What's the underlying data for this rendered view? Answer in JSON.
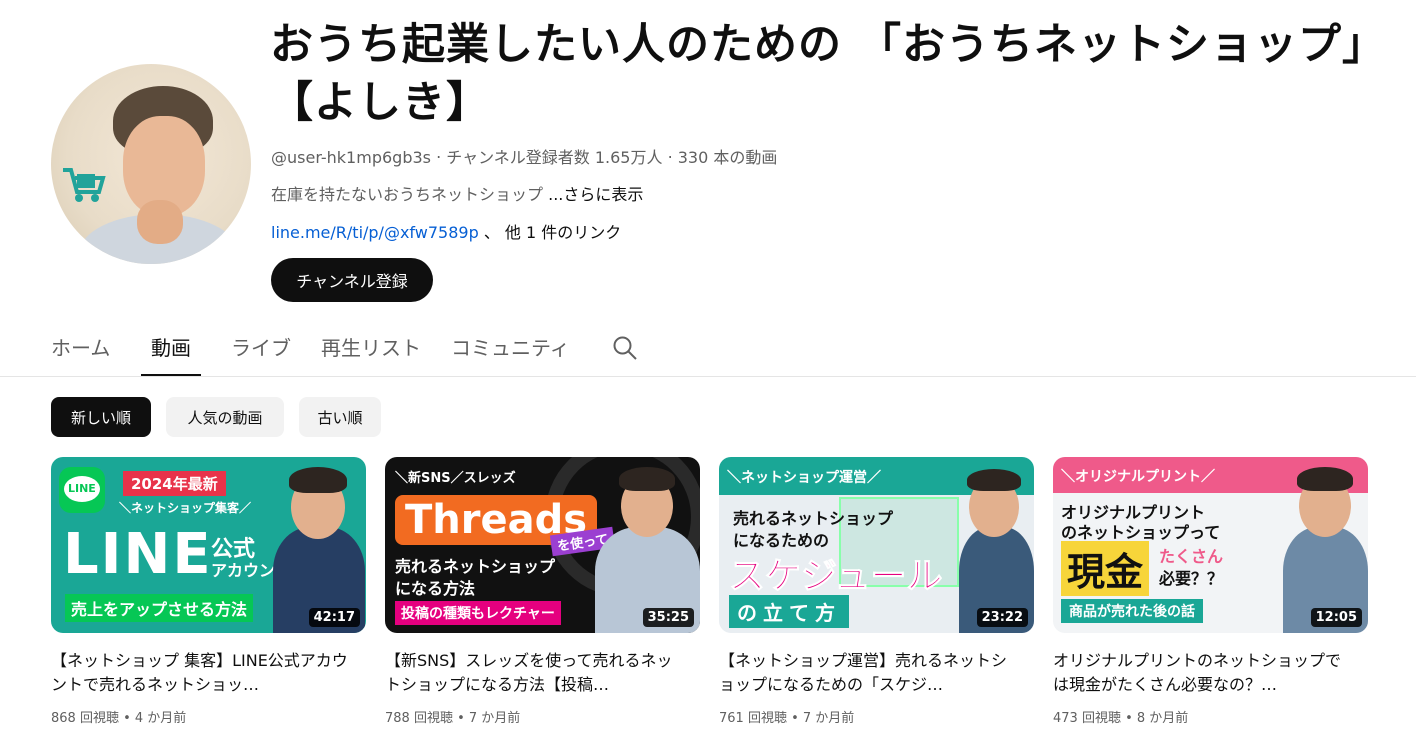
{
  "channel": {
    "title": "おうち起業したい人のための 「おうちネットショップ」【よしき】",
    "handle": "@user-hk1mp6gb3s",
    "subscribers": "チャンネル登録者数 1.65万人",
    "video_count": "330 本の動画",
    "description": "在庫を持たないおうちネットショップ",
    "more_label": "...さらに表示",
    "link": "line.me/R/ti/p/@xfw7589p",
    "other_links": "、 他 1 件のリンク",
    "subscribe_label": "チャンネル登録"
  },
  "tabs": [
    {
      "label": "ホーム"
    },
    {
      "label": "動画"
    },
    {
      "label": "ライブ"
    },
    {
      "label": "再生リスト"
    },
    {
      "label": "コミュニティ"
    }
  ],
  "chips": [
    {
      "label": "新しい順"
    },
    {
      "label": "人気の動画"
    },
    {
      "label": "古い順"
    }
  ],
  "videos": [
    {
      "title": "【ネットショップ 集客】LINE公式アカウントで売れるネットショッ…",
      "views": "868 回視聴",
      "age": "4 か月前",
      "duration": "42:17",
      "thumb_text": {
        "badge": "2024年最新",
        "sub": "＼ネットショップ集客／",
        "big": "LINE",
        "side1": "公式",
        "side2": "アカウントで",
        "bottom": "売上をアップさせる方法",
        "logo": "LINE"
      }
    },
    {
      "title": "【新SNS】スレッズを使って売れるネットショップになる方法【投稿…",
      "views": "788 回視聴",
      "age": "7 か月前",
      "duration": "35:25",
      "thumb_text": {
        "sub": "＼新SNS／スレッズ",
        "big": "Threads",
        "side1": "を使って",
        "mid": "売れるネットショップ",
        "mid2": "になる方法",
        "bottom": "投稿の種類もレクチャー"
      }
    },
    {
      "title": "【ネットショップ運営】売れるネットショップになるための「スケジ…",
      "views": "761 回視聴",
      "age": "7 か月前",
      "duration": "23:22",
      "thumb_text": {
        "sub": "＼ネットショップ運営／",
        "mid": "売れるネットショップ",
        "mid2": "になるための",
        "big": "スケジュール",
        "bottom": "の立て方"
      }
    },
    {
      "title": "オリジナルプリントのネットショップでは現金がたくさん必要なの？…",
      "views": "473 回視聴",
      "age": "8 か月前",
      "duration": "12:05",
      "thumb_text": {
        "sub": "＼オリジナルプリント／",
        "mid": "オリジナルプリント",
        "mid2": "のネットショップって",
        "big": "現金",
        "side1": "たくさん",
        "side2": "必要？？",
        "bottom": "商品が売れた後の話"
      }
    }
  ],
  "colors": {
    "accent_link": "#065fd4",
    "line_green": "#06c755",
    "threads_orange": "#f26b21",
    "schedule_magenta": "#e5007f",
    "print_pink": "#ef5a8a"
  }
}
